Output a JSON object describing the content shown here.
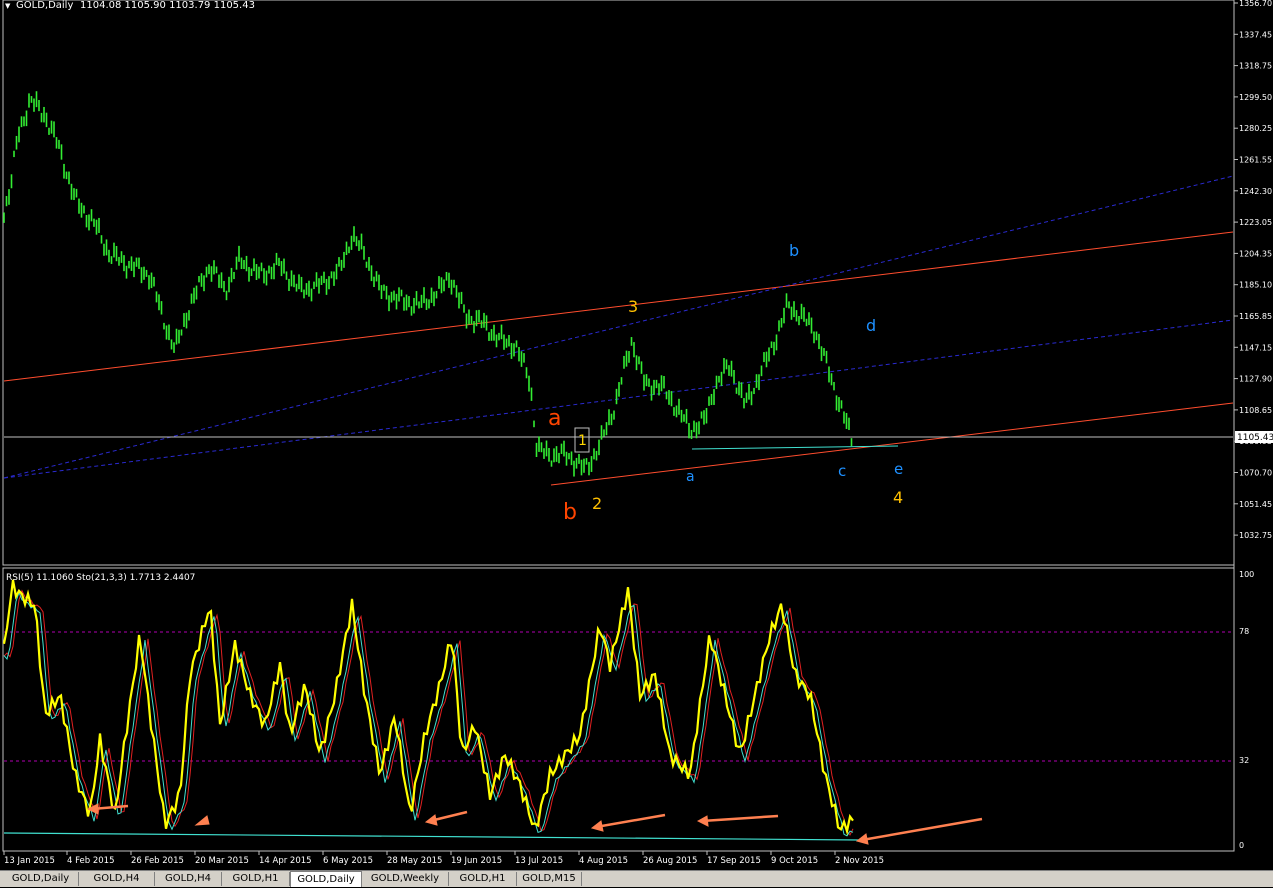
{
  "window": {
    "title": "GOLD,Daily",
    "ohlc": "1104.08 1105.90 1103.79 1105.43",
    "current_price_label": "1105.43"
  },
  "indicator": {
    "label": "RSI(5) 11.1060  Sto(21,3,3) 1.7713 2.4407",
    "levels": [
      "100",
      "78",
      "32",
      "0"
    ]
  },
  "price_axis_ticks": [
    "1356.70",
    "1337.45",
    "1318.75",
    "1299.50",
    "1280.25",
    "1261.55",
    "1242.30",
    "1223.05",
    "1204.35",
    "1185.10",
    "1165.85",
    "1147.15",
    "1127.90",
    "1108.65",
    "1089.95",
    "1070.70",
    "1051.45",
    "1032.75"
  ],
  "date_labels": [
    "13 Jan 2015",
    "4 Feb 2015",
    "26 Feb 2015",
    "20 Mar 2015",
    "14 Apr 2015",
    "6 May 2015",
    "28 May 2015",
    "19 Jun 2015",
    "13 Jul 2015",
    "4 Aug 2015",
    "26 Aug 2015",
    "17 Sep 2015",
    "9 Oct 2015",
    "2 Nov 2015"
  ],
  "wave_labels": [
    {
      "text": "a",
      "color": "#ff4500"
    },
    {
      "text": "b",
      "color": "#ff4500"
    },
    {
      "text": "1",
      "color": "#ffd700"
    },
    {
      "text": "2",
      "color": "#ffc000"
    },
    {
      "text": "3",
      "color": "#ffc000"
    },
    {
      "text": "4",
      "color": "#ffc000"
    },
    {
      "text": "a",
      "color": "#1e90ff"
    },
    {
      "text": "b",
      "color": "#1e90ff"
    },
    {
      "text": "c",
      "color": "#1e90ff"
    },
    {
      "text": "d",
      "color": "#1e90ff"
    },
    {
      "text": "e",
      "color": "#1e90ff"
    }
  ],
  "tabs": [
    {
      "label": "GOLD,Daily",
      "active": false
    },
    {
      "label": "GOLD,H4",
      "active": false
    },
    {
      "label": "GOLD,H4",
      "active": false
    },
    {
      "label": "GOLD,H1",
      "active": false
    },
    {
      "label": "GOLD,Daily",
      "active": true
    },
    {
      "label": "GOLD,Weekly",
      "active": false
    },
    {
      "label": "GOLD,H1",
      "active": false
    },
    {
      "label": "GOLD,M15",
      "active": false
    }
  ]
}
